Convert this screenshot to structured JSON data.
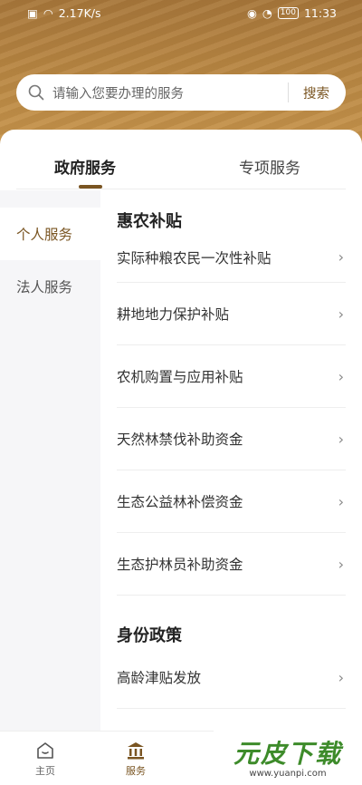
{
  "status_bar": {
    "network_speed": "2.17K/s",
    "battery": "100",
    "time": "11:33"
  },
  "search": {
    "placeholder": "请输入您要办理的服务",
    "button_label": "搜索"
  },
  "tabs": [
    {
      "label": "政府服务",
      "active": true
    },
    {
      "label": "专项服务",
      "active": false
    }
  ],
  "side_nav": [
    {
      "label": "个人服务",
      "active": true
    },
    {
      "label": "法人服务",
      "active": false
    }
  ],
  "sections": [
    {
      "title": "惠农补贴",
      "items": [
        "实际种粮农民一次性补贴",
        "耕地地力保护补贴",
        "农机购置与应用补贴",
        "天然林禁伐补助资金",
        "生态公益林补偿资金",
        "生态护林员补助资金"
      ]
    },
    {
      "title": "身份政策",
      "items": [
        "高龄津贴发放"
      ]
    }
  ],
  "bottom_nav": [
    {
      "label": "主页",
      "icon": "home-icon",
      "active": false
    },
    {
      "label": "服务",
      "icon": "bank-icon",
      "active": true
    }
  ],
  "watermark": {
    "logo": "元皮下载",
    "url": "www.yuanpi.com"
  },
  "colors": {
    "accent": "#7a5522",
    "header_gold": "#b88642"
  }
}
